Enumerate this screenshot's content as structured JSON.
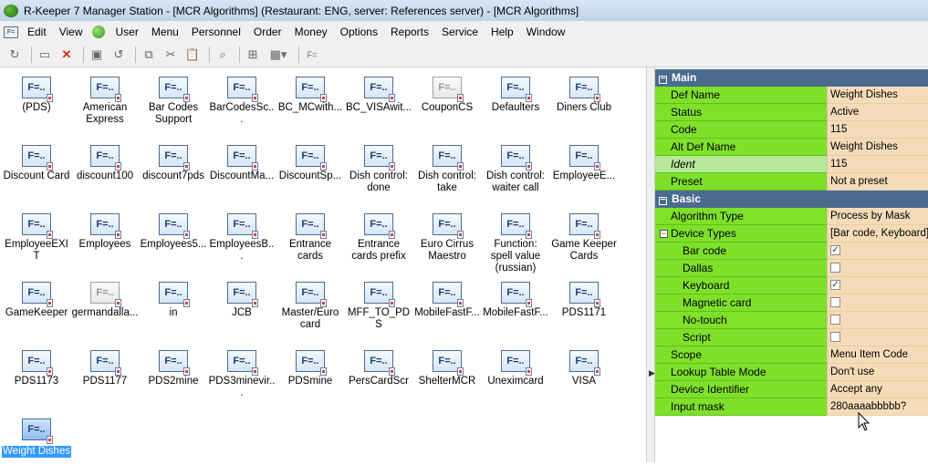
{
  "window": {
    "title": "R-Keeper 7 Manager Station - [MCR Algorithms] (Restaurant: ENG, server: References server) - [MCR Algorithms]"
  },
  "menu": [
    "Edit",
    "View",
    "User",
    "Menu",
    "Personnel",
    "Order",
    "Money",
    "Options",
    "Reports",
    "Service",
    "Help",
    "Window"
  ],
  "toolbar_icons": [
    "refresh-icon",
    "form-icon",
    "delete-icon",
    "save-icon",
    "undo-icon",
    "copy-icon",
    "cut-icon",
    "paste-icon",
    "find-icon",
    "filter-icon",
    "view-mode-icon",
    "form-fx-icon"
  ],
  "grid": {
    "items": [
      {
        "label": "(PDS)"
      },
      {
        "label": "American Express"
      },
      {
        "label": "Bar Codes Support"
      },
      {
        "label": "BarCodesSc..."
      },
      {
        "label": "BC_MCwith..."
      },
      {
        "label": "BC_VISAwit..."
      },
      {
        "label": "CouponCS",
        "gray": true
      },
      {
        "label": "Defaulters"
      },
      {
        "label": "Diners Club"
      },
      {
        "label": "Discount Card"
      },
      {
        "label": "discount100"
      },
      {
        "label": "discount7pds"
      },
      {
        "label": "DiscountMa..."
      },
      {
        "label": "DiscountSp..."
      },
      {
        "label": "Dish control: done"
      },
      {
        "label": "Dish control: take"
      },
      {
        "label": "Dish control: waiter call"
      },
      {
        "label": "EmployeeE..."
      },
      {
        "label": "EmployeeEXIT"
      },
      {
        "label": "Employees"
      },
      {
        "label": "Employees5..."
      },
      {
        "label": "EmployeesB..."
      },
      {
        "label": "Entrance cards"
      },
      {
        "label": "Entrance cards prefix"
      },
      {
        "label": "Euro Cirrus Maestro"
      },
      {
        "label": "Function: spell value (russian)"
      },
      {
        "label": "Game Keeper Cards"
      },
      {
        "label": "GameKeeper"
      },
      {
        "label": "germandalla...",
        "gray": true
      },
      {
        "label": "in"
      },
      {
        "label": "JCB"
      },
      {
        "label": "Master/Euro card"
      },
      {
        "label": "MFF_TO_PDS"
      },
      {
        "label": "MobileFastF..."
      },
      {
        "label": "MobileFastF..."
      },
      {
        "label": "PDS1171"
      },
      {
        "label": "PDS1173"
      },
      {
        "label": "PDS1177"
      },
      {
        "label": "PDS2mine"
      },
      {
        "label": "PDS3minevir..."
      },
      {
        "label": "PDSmine"
      },
      {
        "label": "PersCardScr"
      },
      {
        "label": "ShelterMCR"
      },
      {
        "label": "Uneximcard"
      },
      {
        "label": "VISA"
      },
      {
        "label": "Weight Dishes",
        "selected": true
      }
    ]
  },
  "props": {
    "main_section": "Main",
    "basic_section": "Basic",
    "rows": [
      {
        "key": "Def Name",
        "value": "Weight Dishes"
      },
      {
        "key": "Status",
        "value": "Active"
      },
      {
        "key": "Code",
        "value": "115"
      },
      {
        "key": "Alt Def Name",
        "value": "Weight Dishes"
      },
      {
        "key": "Ident",
        "value": "115"
      },
      {
        "key": "Preset",
        "value": "Not a preset"
      }
    ],
    "basic_rows": [
      {
        "key": "Algorithm Type",
        "value": "Process by Mask"
      },
      {
        "key": "Device Types",
        "value": "[Bar code, Keyboard]"
      },
      {
        "key": "Bar code",
        "checked": true
      },
      {
        "key": "Dallas",
        "checked": false
      },
      {
        "key": "Keyboard",
        "checked": true
      },
      {
        "key": "Magnetic card",
        "checked": false
      },
      {
        "key": "No-touch",
        "checked": false
      },
      {
        "key": "Script",
        "checked": false
      },
      {
        "key": "Scope",
        "value": "Menu Item Code"
      },
      {
        "key": "Lookup Table Mode",
        "value": "Don't use"
      },
      {
        "key": "Device Identifier",
        "value": "Accept any"
      },
      {
        "key": "Input mask",
        "value": "280aaaabbbbb?"
      }
    ]
  }
}
